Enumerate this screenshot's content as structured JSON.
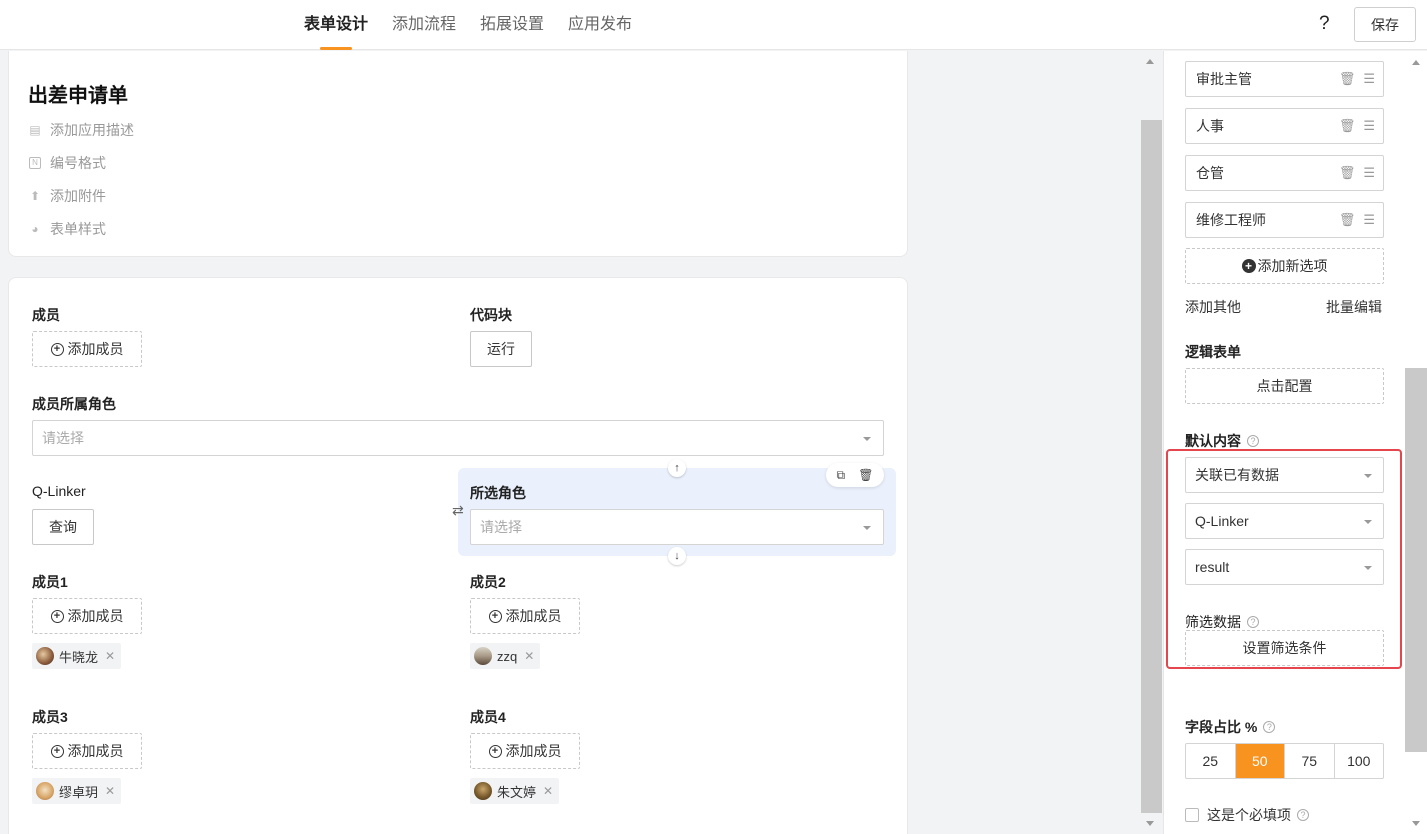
{
  "header": {
    "tabs": [
      {
        "label": "表单设计",
        "active": true
      },
      {
        "label": "添加流程",
        "active": false
      },
      {
        "label": "拓展设置",
        "active": false
      },
      {
        "label": "应用发布",
        "active": false
      }
    ],
    "help_label": "?",
    "save_label": "保存"
  },
  "form": {
    "title": "出差申请单",
    "meta": [
      {
        "label": "添加应用描述",
        "icon": "comment-icon"
      },
      {
        "label": "编号格式",
        "icon": "number-format-icon"
      },
      {
        "label": "添加附件",
        "icon": "upload-icon"
      },
      {
        "label": "表单样式",
        "icon": "palette-icon"
      }
    ],
    "fields": {
      "member_label": "成员",
      "member_add": "添加成员",
      "code_label": "代码块",
      "code_run": "运行",
      "role_label": "成员所属角色",
      "role_placeholder": "请选择",
      "qlinker_label": "Q-Linker",
      "qlinker_query": "查询",
      "selected_role_label": "所选角色",
      "selected_role_placeholder": "请选择",
      "member1_label": "成员1",
      "member1_add": "添加成员",
      "member1_chip": "牛晓龙",
      "member2_label": "成员2",
      "member2_add": "添加成员",
      "member2_chip": "zzq",
      "member3_label": "成员3",
      "member3_add": "添加成员",
      "member3_chip": "缪卓玥",
      "member4_label": "成员4",
      "member4_add": "添加成员",
      "member4_chip": "朱文婷"
    }
  },
  "props": {
    "options": [
      {
        "label": "审批主管"
      },
      {
        "label": "人事"
      },
      {
        "label": "仓管"
      },
      {
        "label": "维修工程师"
      }
    ],
    "add_option": "添加新选项",
    "add_other": "添加其他",
    "batch_edit": "批量编辑",
    "logic_title": "逻辑表单",
    "logic_config": "点击配置",
    "default_title": "默认内容",
    "default_source": "关联已有数据",
    "default_app": "Q-Linker",
    "default_field": "result",
    "filter_title": "筛选数据",
    "filter_button": "设置筛选条件",
    "ratio_title": "字段占比 %",
    "ratio_options": [
      "25",
      "50",
      "75",
      "100"
    ],
    "ratio_selected": "50",
    "required_label": "这是个必填项"
  },
  "colors": {
    "accent": "#f7931e",
    "highlight_border": "#e5464d",
    "selected_bg": "#eaf0fc"
  }
}
